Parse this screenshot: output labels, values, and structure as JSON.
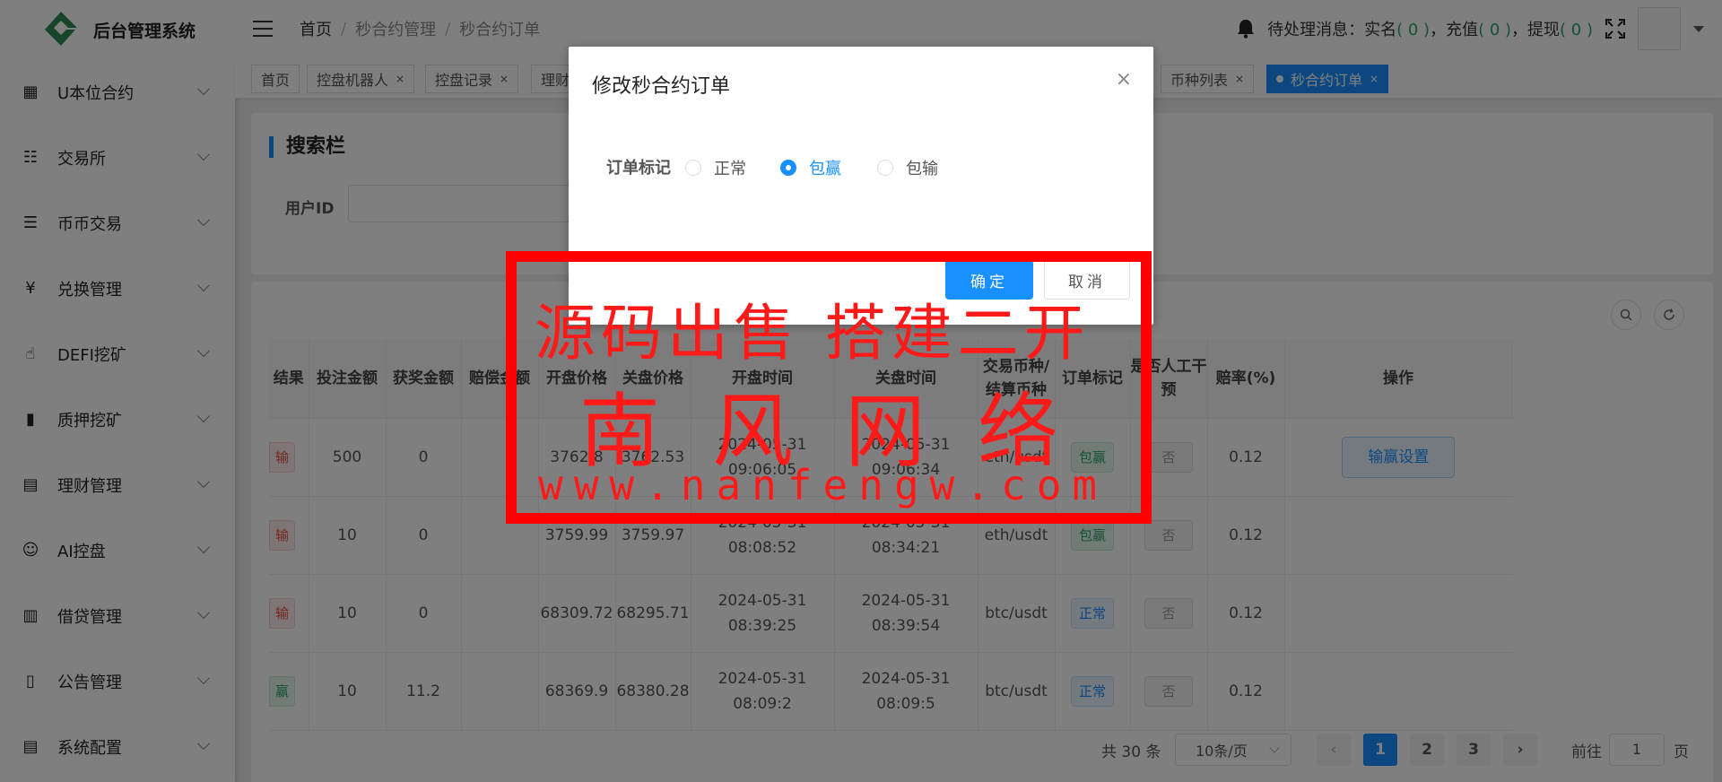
{
  "app": {
    "title": "后台管理系统"
  },
  "sidebar": {
    "items": [
      {
        "label": "U本位合约",
        "icon": "grid-icon"
      },
      {
        "label": "交易所",
        "icon": "list-tree-icon"
      },
      {
        "label": "币币交易",
        "icon": "list-icon"
      },
      {
        "label": "兑换管理",
        "icon": "yen-icon"
      },
      {
        "label": "DEFI挖矿",
        "icon": "hand-icon"
      },
      {
        "label": "质押挖矿",
        "icon": "bar-chart-icon"
      },
      {
        "label": "理财管理",
        "icon": "document-icon"
      },
      {
        "label": "AI控盘",
        "icon": "robot-icon"
      },
      {
        "label": "借贷管理",
        "icon": "book-icon"
      },
      {
        "label": "公告管理",
        "icon": "open-book-icon"
      },
      {
        "label": "系统配置",
        "icon": "document-icon"
      }
    ]
  },
  "header": {
    "breadcrumb": [
      "首页",
      "秒合约管理",
      "秒合约订单"
    ],
    "messages": {
      "label": "待处理消息：",
      "realname_label": "实名",
      "realname_count": "( 0 )",
      "recharge_label": "充值",
      "recharge_count": "( 0 )",
      "withdraw_label": "提现",
      "withdraw_count": "( 0 )",
      "comma": "，"
    }
  },
  "tabs": [
    {
      "label": "首页",
      "closable": false
    },
    {
      "label": "控盘机器人",
      "closable": true
    },
    {
      "label": "控盘记录",
      "closable": true
    },
    {
      "label": "理财",
      "closable": false
    },
    {
      "label": "币种列表",
      "closable": true
    },
    {
      "label": "秒合约订单",
      "closable": true,
      "active": true
    }
  ],
  "tab_close_glyph": "×",
  "search": {
    "title": "搜索栏",
    "user_id_label": "用户ID"
  },
  "table": {
    "headers": [
      "结果",
      "投注金额",
      "获奖金额",
      "赔偿金额",
      "开盘价格",
      "关盘价格",
      "开盘时间",
      "关盘时间",
      "交易币种/结算币种",
      "订单标记",
      "是否人工干预",
      "赔率(%)",
      "操作"
    ],
    "rows": [
      {
        "result": "输",
        "bet": "500",
        "award": "0",
        "comp": "",
        "open_price": "3762.8",
        "close_price": "3762.53",
        "open_time": "2024-05-31 09:06:05",
        "close_time": "2024-05-31 09:06:34",
        "pair": "eth/usdt",
        "mark": "包赢",
        "manual": "否",
        "rate": "0.12",
        "op": "输赢设置"
      },
      {
        "result": "输",
        "bet": "10",
        "award": "0",
        "comp": "",
        "open_price": "3759.99",
        "close_price": "3759.97",
        "open_time": "2024-05-31 08:08:52",
        "close_time": "2024-05-31 08:34:21",
        "pair": "eth/usdt",
        "mark": "包赢",
        "manual": "否",
        "rate": "0.12",
        "op": ""
      },
      {
        "result": "输",
        "bet": "10",
        "award": "0",
        "comp": "",
        "open_price": "68309.72",
        "close_price": "68295.71",
        "open_time": "2024-05-31 08:39:25",
        "close_time": "2024-05-31 08:39:54",
        "pair": "btc/usdt",
        "mark": "正常",
        "manual": "否",
        "rate": "0.12",
        "op": ""
      },
      {
        "result": "赢",
        "bet": "10",
        "award": "11.2",
        "comp": "",
        "open_price": "68369.9",
        "close_price": "68380.28",
        "open_time": "2024-05-31 08:09:2",
        "close_time": "2024-05-31 08:09:5",
        "pair": "btc/usdt",
        "mark": "正常",
        "manual": "否",
        "rate": "0.12",
        "op": ""
      }
    ]
  },
  "pagination": {
    "total": "共 30 条",
    "page_size": "10条/页",
    "pages": [
      "1",
      "2",
      "3"
    ],
    "prev": "‹",
    "next": "›",
    "goto_label": "前往",
    "goto_value": "1",
    "goto_unit": "页"
  },
  "dialog": {
    "title": "修改秒合约订单",
    "close": "×",
    "field_label": "订单标记",
    "options": [
      {
        "label": "正常",
        "checked": false
      },
      {
        "label": "包赢",
        "checked": true
      },
      {
        "label": "包输",
        "checked": false
      }
    ],
    "ok_label": "确定",
    "cancel_label": "取消"
  },
  "watermark": {
    "line1": "源码出售 搭建二开",
    "line2": "南风网络",
    "line3": "www.nanfengw.com"
  },
  "colors": {
    "primary": "#1890ff",
    "success": "#2aa36a",
    "danger": "#e74c3c",
    "watermark": "#ff0000"
  }
}
